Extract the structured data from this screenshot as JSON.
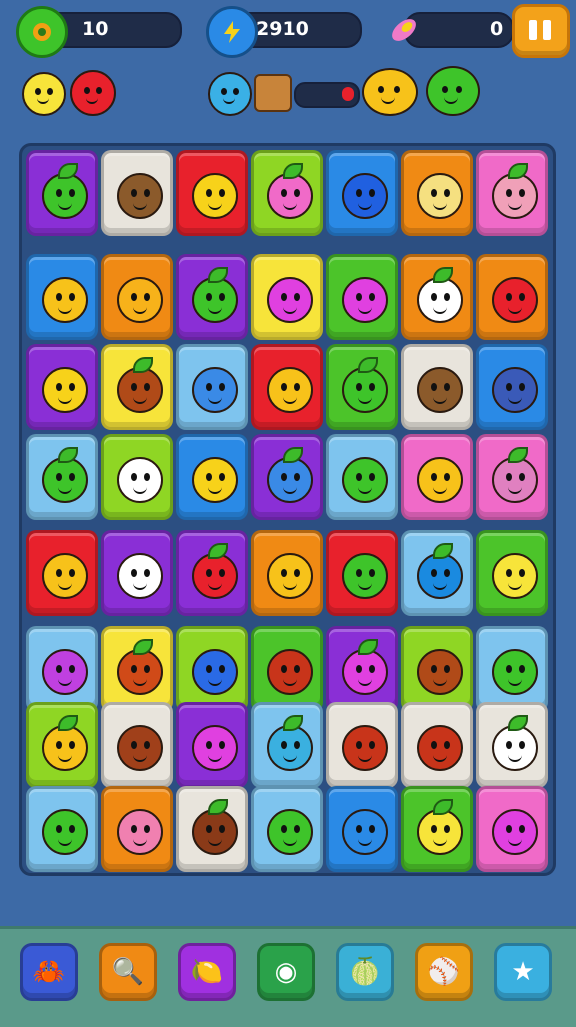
{
  "hud": {
    "left_value": "10",
    "middle_value": "2910",
    "right_value": "0"
  },
  "colors": {
    "tile_purple": "#8a2fd6",
    "tile_white": "#e8e4dc",
    "tile_red": "#e8212c",
    "tile_lime": "#8fd624",
    "tile_blue": "#2a8ae6",
    "tile_orange": "#f08a14",
    "tile_pink": "#f06ac8",
    "tile_yellow": "#f7e43a",
    "tile_green": "#4cc42a",
    "tile_sky": "#7ec4ee"
  },
  "board": {
    "rows": [
      [
        "purple",
        "white",
        "red",
        "lime",
        "blue",
        "orange",
        "pink"
      ],
      [
        "blue",
        "orange",
        "purple",
        "yellow",
        "green",
        "orange",
        "orange"
      ],
      [
        "purple",
        "yellow",
        "sky",
        "red",
        "green",
        "white",
        "blue"
      ],
      [
        "sky",
        "lime",
        "blue",
        "purple",
        "sky",
        "pink",
        "pink"
      ],
      [
        "red",
        "purple",
        "purple",
        "orange",
        "red",
        "sky",
        "green"
      ],
      [
        "sky",
        "yellow",
        "lime",
        "green",
        "purple",
        "lime",
        "sky"
      ],
      [
        "lime",
        "white",
        "purple",
        "sky",
        "white",
        "white",
        "white"
      ],
      [
        "sky",
        "orange",
        "white",
        "sky",
        "blue",
        "green",
        "pink"
      ]
    ],
    "creatures": [
      [
        "#3ec42a",
        "#8b5a2b",
        "#f7d21a",
        "#f06ac8",
        "#2060e0",
        "#f5e080",
        "#f0a0b8"
      ],
      [
        "#f7c21a",
        "#f7b21a",
        "#3ec42a",
        "#e040e0",
        "#e040e0",
        "#ffffff",
        "#e8212c"
      ],
      [
        "#f7d21a",
        "#b04a18",
        "#3a8ae6",
        "#f7c21a",
        "#3ec42a",
        "#8b5a2b",
        "#3a5ab8"
      ],
      [
        "#3ec42a",
        "#ffffff",
        "#f7d21a",
        "#3a8ae6",
        "#3ec42a",
        "#f7c21a",
        "#e080c0"
      ],
      [
        "#f7c21a",
        "#ffffff",
        "#e8212c",
        "#f7c21a",
        "#3ec42a",
        "#1a8ae0",
        "#f7e43a"
      ],
      [
        "#c040e0",
        "#d04a18",
        "#2a6ae6",
        "#c8341a",
        "#e040e0",
        "#b04a18",
        "#3ec42a"
      ],
      [
        "#f7c21a",
        "#a0401a",
        "#e040e0",
        "#3ab0e0",
        "#c8341a",
        "#c8341a",
        "#ffffff"
      ],
      [
        "#3ec42a",
        "#f080b0",
        "#8a3a18",
        "#3ec42a",
        "#2a8ae6",
        "#f7e43a",
        "#e040e0"
      ]
    ]
  },
  "bottom_buttons": [
    {
      "name": "creature-button-icon",
      "color": "#3a5ad6",
      "symbol": "🦀"
    },
    {
      "name": "search-button-icon",
      "color": "#f08a14",
      "symbol": "🔍"
    },
    {
      "name": "shovel-button-icon",
      "color": "#a030e0",
      "symbol": "🍋"
    },
    {
      "name": "target-button-icon",
      "color": "#2aa24a",
      "symbol": "◉"
    },
    {
      "name": "leaf-button-icon",
      "color": "#3ab0d6",
      "symbol": "🍈"
    },
    {
      "name": "ball-button-icon",
      "color": "#f0a014",
      "symbol": "⚾"
    },
    {
      "name": "star-button-icon",
      "color": "#3ab0e0",
      "symbol": "★"
    }
  ]
}
